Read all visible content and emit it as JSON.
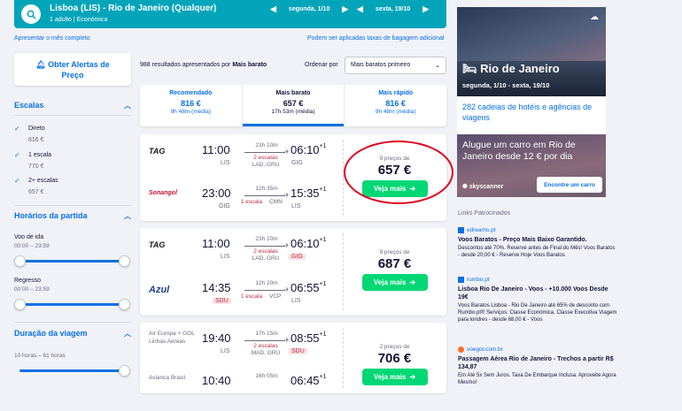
{
  "header": {
    "route": "Lisboa (LIS) - Rio de Janeiro (Qualquer)",
    "passengers": "1 adulto",
    "cabin": "Económica",
    "depart_date": "segunda, 1/10",
    "return_date": "sexta, 19/10",
    "prev_arrow": "◀",
    "next_arrow": "▶"
  },
  "links": {
    "full_month": "Apresentar o mês completo",
    "baggage": "Podem ser aplicadas taxas de bagagem adicional"
  },
  "filters": {
    "alert_button": "Obter Alertas de Preço",
    "stops_title": "Escalas",
    "stops": [
      {
        "label": "Direto",
        "price": "816 €"
      },
      {
        "label": "1 escala",
        "price": "770 €"
      },
      {
        "label": "2+ escalas",
        "price": "657 €"
      }
    ],
    "times_title": "Horários da partida",
    "outbound_label": "Voo de ida",
    "outbound_range": "00:00 – 23:59",
    "return_label": "Regresso",
    "return_range": "00:00 – 23:59",
    "duration_title": "Duração da viagem",
    "duration_range": "10 horas – 61 horas"
  },
  "results": {
    "count_text": "988 resultados apresentados por",
    "count_sort": "Mais barato",
    "sort_label": "Ordenar por",
    "sort_value": "Mais baratos primeiro",
    "tabs": [
      {
        "name": "Recomendado",
        "price": "816 €",
        "duration": "9h 48m (média)"
      },
      {
        "name": "Mais barato",
        "price": "657 €",
        "duration": "17h 53m (média)"
      },
      {
        "name": "Mais rápido",
        "price": "816 €",
        "duration": "9h 48m (média)"
      }
    ],
    "cards": [
      {
        "legs": [
          {
            "airline": "TAG",
            "dep": "11:00",
            "dep_ap": "LIS",
            "dur": "23h 10m",
            "stops": "2 escalas",
            "via": "LAD, GRU",
            "arr": "06:10",
            "plus": "+1",
            "arr_ap": "GIG"
          },
          {
            "airline": "Sonangol",
            "dep": "23:00",
            "dep_ap": "GIG",
            "dur": "12h 35m",
            "stops": "1 escala",
            "via": "CMN",
            "arr": "15:35",
            "plus": "+1",
            "arr_ap": "LIS"
          }
        ],
        "num_prices": "9 preços de",
        "price": "657 €",
        "button": "Veja mais"
      },
      {
        "legs": [
          {
            "airline": "TAG",
            "dep": "11:00",
            "dep_ap": "LIS",
            "dur": "23h 10m",
            "stops": "2 escalas",
            "via": "LAD, GRU",
            "arr": "06:10",
            "plus": "+1",
            "arr_ap": "GIG"
          },
          {
            "airline": "Azul",
            "dep": "14:35",
            "dep_ap": "SDU",
            "dur": "12h 20m",
            "stops": "1 escala",
            "via": "VCP",
            "arr": "06:55",
            "plus": "+1",
            "arr_ap": "LIS"
          }
        ],
        "num_prices": "9 preços de",
        "price": "687 €",
        "button": "Veja mais"
      },
      {
        "legs": [
          {
            "airline": "Air Europa + GOL Linhas Aéreas",
            "dep": "19:40",
            "dep_ap": "LIS",
            "dur": "17h 15m",
            "stops": "2 escalas",
            "via": "MAD, GRU",
            "arr": "08:55",
            "plus": "+1",
            "arr_ap": "SDU"
          },
          {
            "airline": "Avianca Brasil",
            "dep": "10:40",
            "dep_ap": "",
            "dur": "16h 05m",
            "stops": "",
            "via": "",
            "arr": "06:45",
            "plus": "+1",
            "arr_ap": ""
          }
        ],
        "num_prices": "2 preços de",
        "price": "706 €",
        "button": "Veja mais"
      }
    ]
  },
  "ads": {
    "city": "Rio de Janeiro",
    "dates": "segunda, 1/10 - sexta, 19/10",
    "hotels": "282 cadeias de hotéis e agências de viagens",
    "car_text": "Alugue um carro em Rio de Janeiro desde 12 € por dia",
    "skyscanner": "skyscanner",
    "car_button": "Encontre um carro",
    "sponsored": "Links Patrocinados",
    "text_ads": [
      {
        "src": "edreams.pt",
        "title": "Voos Baratos - Preço Mais Baixo Garantido.",
        "text": "Descontos até 70%. Reserve antes de Final do Mês! Voos Baratos - desde 20,00 € - Reserve Hoje Voos Baratos"
      },
      {
        "src": "rumbo.pt",
        "title": "Lisboa Rio De Janeiro - Voos - +10.000 Voos Desde 19€",
        "text": "Voos Baratos Lisboa - Rio De Janeiro até 65% de desconto com Rumbo.pt® Serviços: Classe Económica, Classe Executiva Viagem para londres - desde 68,00 € - Voos"
      },
      {
        "src": "voegol.com.br",
        "title": "Passagem Aérea Rio de Janeiro - Trechos a partir R$ 134,87",
        "text": "Em Até 5x Sem Juros. Taxa De Embarque Inclusa. Aproveite Agora Mesmo!"
      }
    ]
  },
  "colors": {
    "accent": "#0770e3",
    "header": "#02a4ba",
    "cta": "#00d775",
    "highlight_circle": "#e0001b"
  }
}
